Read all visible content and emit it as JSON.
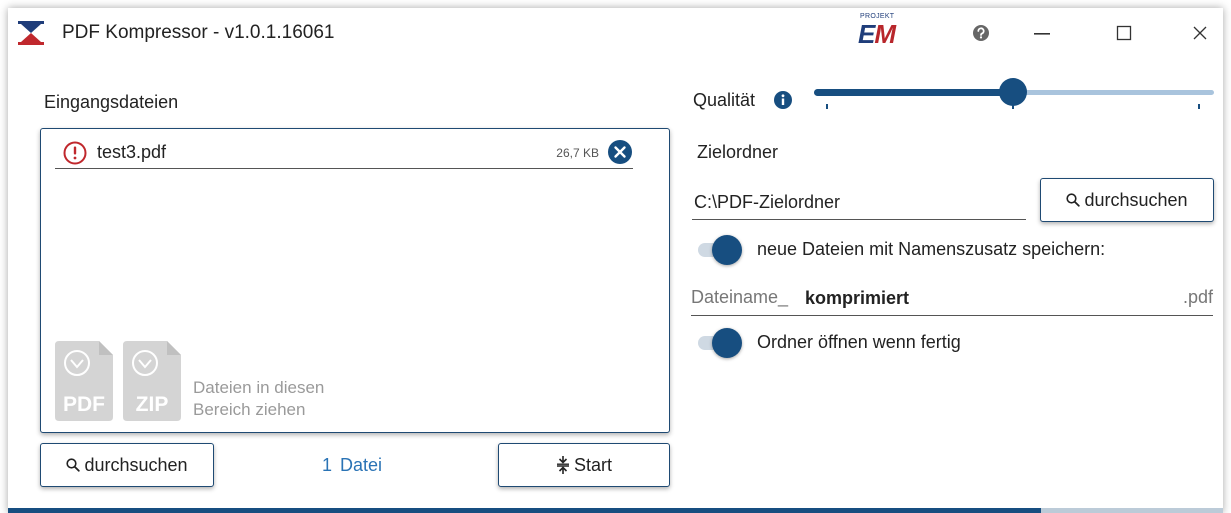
{
  "window": {
    "title": "PDF Kompressor - v1.0.1.16061",
    "brand_small": "PROJEKT",
    "brand_main_e": "E",
    "brand_main_m": "M"
  },
  "input": {
    "label": "Eingangsdateien",
    "files": [
      {
        "name": "test3.pdf",
        "size": "26,7 KB",
        "status": "warning"
      }
    ],
    "drop_hint_line1": "Dateien in diesen",
    "drop_hint_line2": "Bereich ziehen",
    "drop_icon_pdf": "PDF",
    "drop_icon_zip": "ZIP",
    "browse_label": "durchsuchen",
    "count_number": "1",
    "count_unit": "Datei",
    "start_label": "Start"
  },
  "settings": {
    "quality_label": "Qualität",
    "quality_level": 0.5,
    "target_label": "Zielordner",
    "target_path": "C:\\PDF-Zielordner",
    "browse_label": "durchsuchen",
    "suffix_toggle_label": "neue Dateien mit Namenszusatz speichern:",
    "suffix_toggle_on": true,
    "filename_prefix": "Dateiname_",
    "filename_suffix": "komprimiert",
    "filename_ext": ".pdf",
    "open_toggle_label": "Ordner öffnen wenn fertig",
    "open_toggle_on": true
  },
  "progress": {
    "fraction": 0.85
  },
  "colors": {
    "accent": "#174e80",
    "link": "#2a73b5",
    "warning": "#c0282d",
    "track": "#a9c4dd"
  },
  "icons": {
    "app": "app-logo-icon",
    "help": "help-icon",
    "minimize": "minimize-icon",
    "maximize": "maximize-icon",
    "close": "close-icon",
    "warning": "warning-icon",
    "remove": "remove-icon",
    "search": "search-icon",
    "start": "compress-icon",
    "info": "info-icon"
  }
}
